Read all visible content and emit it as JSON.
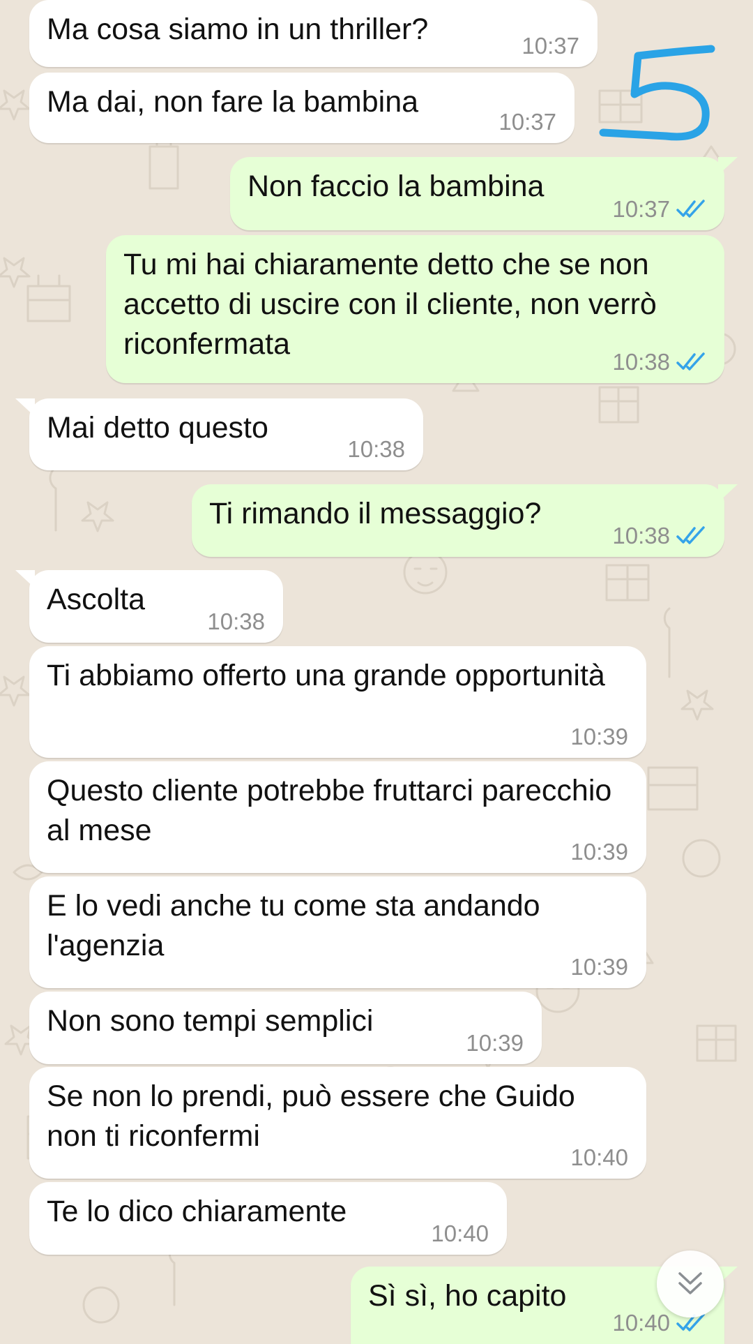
{
  "messages": [
    {
      "dir": "in",
      "text": "Ma cosa siamo in un thriller?",
      "time": "10:37"
    },
    {
      "dir": "in",
      "text": "Ma dai, non fare la bambina",
      "time": "10:37"
    },
    {
      "dir": "out",
      "text": "Non faccio la bambina",
      "time": "10:37",
      "read": true
    },
    {
      "dir": "out",
      "text": "Tu mi hai chiaramente detto che se non accetto di uscire con il cliente, non verrò riconfermata",
      "time": "10:38",
      "read": true
    },
    {
      "dir": "in",
      "text": "Mai detto questo",
      "time": "10:38"
    },
    {
      "dir": "out",
      "text": "Ti rimando il messaggio?",
      "time": "10:38",
      "read": true
    },
    {
      "dir": "in",
      "text": "Ascolta",
      "time": "10:38"
    },
    {
      "dir": "in",
      "text": "Ti abbiamo offerto una grande opportunità",
      "time": "10:39"
    },
    {
      "dir": "in",
      "text": "Questo cliente potrebbe fruttarci parecchio al mese",
      "time": "10:39"
    },
    {
      "dir": "in",
      "text": "E lo vedi anche tu come sta andando l'agenzia",
      "time": "10:39"
    },
    {
      "dir": "in",
      "text": "Non sono tempi semplici",
      "time": "10:39"
    },
    {
      "dir": "in",
      "text": "Se non lo prendi, può essere che Guido non ti riconfermi",
      "time": "10:40"
    },
    {
      "dir": "in",
      "text": "Te lo dico chiaramente",
      "time": "10:40"
    },
    {
      "dir": "out",
      "text": "Sì sì, ho capito",
      "time": "10:40",
      "read": true
    }
  ],
  "annotation": {
    "icon": "handwritten-number-five",
    "color": "#2aa3e6"
  },
  "scroll_button": {
    "icon": "chevron-double-down-icon"
  },
  "colors": {
    "background": "#ece4d9",
    "incoming_bubble": "#ffffff",
    "outgoing_bubble": "#e6ffd6",
    "read_tick": "#34a3e9",
    "timestamp": "#8e8e8e"
  }
}
